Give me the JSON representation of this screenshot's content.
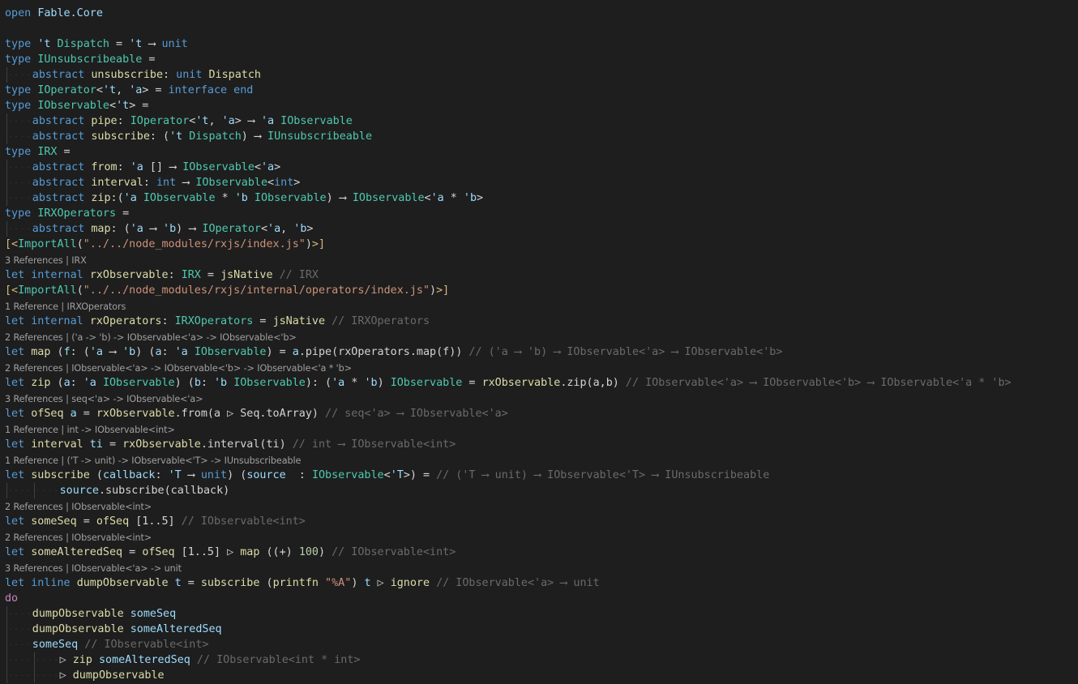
{
  "editor": {
    "language": "F#",
    "lines": [
      {
        "type": "code",
        "indent": 0,
        "tokens": [
          [
            "kw",
            "open "
          ],
          [
            "ty2",
            "Fable.Core"
          ]
        ]
      },
      {
        "type": "code",
        "indent": 0,
        "tokens": [
          [
            "op",
            ""
          ]
        ]
      },
      {
        "type": "code",
        "indent": 0,
        "tokens": [
          [
            "kw",
            "type "
          ],
          [
            "tv",
            "'t "
          ],
          [
            "ty",
            "Dispatch"
          ],
          [
            "op",
            " = "
          ],
          [
            "tv",
            "'t"
          ],
          [
            "op",
            " ⟶ "
          ],
          [
            "kw",
            "unit"
          ]
        ]
      },
      {
        "type": "code",
        "indent": 0,
        "tokens": [
          [
            "kw",
            "type "
          ],
          [
            "ty",
            "IUnsubscribeable"
          ],
          [
            "op",
            " ="
          ]
        ]
      },
      {
        "type": "code",
        "indent": 1,
        "tokens": [
          [
            "kw",
            "abstract "
          ],
          [
            "fn",
            "unsubscribe"
          ],
          [
            "op",
            ": "
          ],
          [
            "kw",
            "unit "
          ],
          [
            "fn",
            "Dispatch"
          ]
        ]
      },
      {
        "type": "code",
        "indent": 0,
        "tokens": [
          [
            "kw",
            "type "
          ],
          [
            "ty",
            "IOperator"
          ],
          [
            "op",
            "<"
          ],
          [
            "tv",
            "'t"
          ],
          [
            "op",
            ", "
          ],
          [
            "tv",
            "'a"
          ],
          [
            "op",
            "> = "
          ],
          [
            "kw",
            "interface end"
          ]
        ]
      },
      {
        "type": "code",
        "indent": 0,
        "tokens": [
          [
            "kw",
            "type "
          ],
          [
            "ty",
            "IObservable"
          ],
          [
            "op",
            "<"
          ],
          [
            "tv",
            "'t"
          ],
          [
            "op",
            "> ="
          ]
        ]
      },
      {
        "type": "code",
        "indent": 1,
        "tokens": [
          [
            "kw",
            "abstract "
          ],
          [
            "fn",
            "pipe"
          ],
          [
            "op",
            ": "
          ],
          [
            "ty",
            "IOperator"
          ],
          [
            "op",
            "<"
          ],
          [
            "tv",
            "'t"
          ],
          [
            "op",
            ", "
          ],
          [
            "tv",
            "'a"
          ],
          [
            "op",
            "> ⟶ "
          ],
          [
            "tv",
            "'a "
          ],
          [
            "ty",
            "IObservable"
          ]
        ]
      },
      {
        "type": "code",
        "indent": 1,
        "tokens": [
          [
            "kw",
            "abstract "
          ],
          [
            "fn",
            "subscribe"
          ],
          [
            "op",
            ": ("
          ],
          [
            "tv",
            "'t "
          ],
          [
            "ty",
            "Dispatch"
          ],
          [
            "op",
            ") ⟶ "
          ],
          [
            "ty",
            "IUnsubscribeable"
          ]
        ]
      },
      {
        "type": "code",
        "indent": 0,
        "tokens": [
          [
            "kw",
            "type "
          ],
          [
            "ty",
            "IRX"
          ],
          [
            "op",
            " ="
          ]
        ]
      },
      {
        "type": "code",
        "indent": 1,
        "tokens": [
          [
            "kw",
            "abstract "
          ],
          [
            "fn",
            "from"
          ],
          [
            "op",
            ": "
          ],
          [
            "tv",
            "'a "
          ],
          [
            "op",
            "[] ⟶ "
          ],
          [
            "ty",
            "IObservable"
          ],
          [
            "op",
            "<"
          ],
          [
            "tv",
            "'a"
          ],
          [
            "op",
            ">"
          ]
        ]
      },
      {
        "type": "code",
        "indent": 1,
        "tokens": [
          [
            "kw",
            "abstract "
          ],
          [
            "fn",
            "interval"
          ],
          [
            "op",
            ": "
          ],
          [
            "kw",
            "int"
          ],
          [
            "op",
            " ⟶ "
          ],
          [
            "ty",
            "IObservable"
          ],
          [
            "op",
            "<"
          ],
          [
            "kw",
            "int"
          ],
          [
            "op",
            ">"
          ]
        ]
      },
      {
        "type": "code",
        "indent": 1,
        "tokens": [
          [
            "kw",
            "abstract "
          ],
          [
            "fn",
            "zip"
          ],
          [
            "op",
            ":("
          ],
          [
            "tv",
            "'a "
          ],
          [
            "ty",
            "IObservable"
          ],
          [
            "op",
            " * "
          ],
          [
            "tv",
            "'b "
          ],
          [
            "ty",
            "IObservable"
          ],
          [
            "op",
            ") ⟶ "
          ],
          [
            "ty",
            "IObservable"
          ],
          [
            "op",
            "<"
          ],
          [
            "tv",
            "'a"
          ],
          [
            "op",
            " * "
          ],
          [
            "tv",
            "'b"
          ],
          [
            "op",
            ">"
          ]
        ]
      },
      {
        "type": "code",
        "indent": 0,
        "tokens": [
          [
            "kw",
            "type "
          ],
          [
            "ty",
            "IRXOperators"
          ],
          [
            "op",
            " ="
          ]
        ]
      },
      {
        "type": "code",
        "indent": 1,
        "tokens": [
          [
            "kw",
            "abstract "
          ],
          [
            "fn",
            "map"
          ],
          [
            "op",
            ": ("
          ],
          [
            "tv",
            "'a"
          ],
          [
            "op",
            " ⟶ "
          ],
          [
            "tv",
            "'b"
          ],
          [
            "op",
            ") ⟶ "
          ],
          [
            "ty",
            "IOperator"
          ],
          [
            "op",
            "<"
          ],
          [
            "tv",
            "'a"
          ],
          [
            "op",
            ", "
          ],
          [
            "tv",
            "'b"
          ],
          [
            "op",
            ">"
          ]
        ]
      },
      {
        "type": "code",
        "indent": 0,
        "tokens": [
          [
            "attr",
            "[<"
          ],
          [
            "ty",
            "ImportAll"
          ],
          [
            "op",
            "("
          ],
          [
            "str",
            "\"../../node_modules/rxjs/index.js\""
          ],
          [
            "op",
            ")"
          ],
          [
            "attr",
            ">]"
          ]
        ]
      },
      {
        "type": "lens",
        "text": "3 References | IRX"
      },
      {
        "type": "code",
        "indent": 0,
        "tokens": [
          [
            "kw",
            "let "
          ],
          [
            "kw",
            "internal "
          ],
          [
            "fn",
            "rxObservable"
          ],
          [
            "op",
            ": "
          ],
          [
            "ty",
            "IRX"
          ],
          [
            "op",
            " = "
          ],
          [
            "fn",
            "jsNative"
          ],
          [
            "cm",
            " // IRX"
          ]
        ]
      },
      {
        "type": "code",
        "indent": 0,
        "tokens": [
          [
            "attr",
            "[<"
          ],
          [
            "ty",
            "ImportAll"
          ],
          [
            "op",
            "("
          ],
          [
            "str",
            "\"../../node_modules/rxjs/internal/operators/index.js\""
          ],
          [
            "op",
            ")"
          ],
          [
            "attr",
            ">]"
          ]
        ]
      },
      {
        "type": "lens",
        "text": "1 Reference | IRXOperators"
      },
      {
        "type": "code",
        "indent": 0,
        "tokens": [
          [
            "kw",
            "let "
          ],
          [
            "kw",
            "internal "
          ],
          [
            "fn",
            "rxOperators"
          ],
          [
            "op",
            ": "
          ],
          [
            "ty",
            "IRXOperators"
          ],
          [
            "op",
            " = "
          ],
          [
            "fn",
            "jsNative"
          ],
          [
            "cm",
            " // IRXOperators"
          ]
        ]
      },
      {
        "type": "lens",
        "text": "2 References | ('a -> 'b) -> IObservable<'a> -> IObservable<'b>"
      },
      {
        "type": "code",
        "indent": 0,
        "tokens": [
          [
            "kw",
            "let "
          ],
          [
            "fn",
            "map"
          ],
          [
            "op",
            " ("
          ],
          [
            "id",
            "f"
          ],
          [
            "op",
            ": ("
          ],
          [
            "tv",
            "'a"
          ],
          [
            "op",
            " ⟶ "
          ],
          [
            "tv",
            "'b"
          ],
          [
            "op",
            ") ("
          ],
          [
            "id",
            "a"
          ],
          [
            "op",
            ": "
          ],
          [
            "tv",
            "'a "
          ],
          [
            "ty",
            "IObservable"
          ],
          [
            "op",
            ") = "
          ],
          [
            "id",
            "a"
          ],
          [
            "op",
            ".pipe(rxOperators.map(f))"
          ],
          [
            "cm",
            " // ('a ⟶ 'b) ⟶ IObservable<'a> ⟶ IObservable<'b>"
          ]
        ]
      },
      {
        "type": "lens",
        "text": "2 References | IObservable<'a> -> IObservable<'b> -> IObservable<'a * 'b>"
      },
      {
        "type": "code",
        "indent": 0,
        "tokens": [
          [
            "kw",
            "let "
          ],
          [
            "fn",
            "zip"
          ],
          [
            "op",
            " ("
          ],
          [
            "id",
            "a"
          ],
          [
            "op",
            ": "
          ],
          [
            "tv",
            "'a "
          ],
          [
            "ty",
            "IObservable"
          ],
          [
            "op",
            ") ("
          ],
          [
            "id",
            "b"
          ],
          [
            "op",
            ": "
          ],
          [
            "tv",
            "'b "
          ],
          [
            "ty",
            "IObservable"
          ],
          [
            "op",
            "): ("
          ],
          [
            "tv",
            "'a"
          ],
          [
            "op",
            " * "
          ],
          [
            "tv",
            "'b"
          ],
          [
            "op",
            ") "
          ],
          [
            "ty",
            "IObservable"
          ],
          [
            "op",
            " = "
          ],
          [
            "fn",
            "rxObservable"
          ],
          [
            "op",
            ".zip(a,b)"
          ],
          [
            "cm",
            " // IObservable<'a> ⟶ IObservable<'b> ⟶ IObservable<'a * 'b>"
          ]
        ]
      },
      {
        "type": "lens",
        "text": "3 References | seq<'a> -> IObservable<'a>"
      },
      {
        "type": "code",
        "indent": 0,
        "tokens": [
          [
            "kw",
            "let "
          ],
          [
            "fn",
            "ofSeq"
          ],
          [
            "id",
            " a"
          ],
          [
            "op",
            " = "
          ],
          [
            "fn",
            "rxObservable"
          ],
          [
            "op",
            ".from(a ▷ Seq.toArray)"
          ],
          [
            "cm",
            " // seq<'a> ⟶ IObservable<'a>"
          ]
        ]
      },
      {
        "type": "lens",
        "text": "1 Reference | int -> IObservable<int>"
      },
      {
        "type": "code",
        "indent": 0,
        "tokens": [
          [
            "kw",
            "let "
          ],
          [
            "fn",
            "interval"
          ],
          [
            "id",
            " ti"
          ],
          [
            "op",
            " = "
          ],
          [
            "fn",
            "rxObservable"
          ],
          [
            "op",
            ".interval(ti)"
          ],
          [
            "cm",
            " // int ⟶ IObservable<int>"
          ]
        ]
      },
      {
        "type": "lens",
        "text": "1 Reference | ('T -> unit) -> IObservable<'T> -> IUnsubscribeable"
      },
      {
        "type": "code",
        "indent": 0,
        "tokens": [
          [
            "kw",
            "let "
          ],
          [
            "fn",
            "subscribe"
          ],
          [
            "op",
            " ("
          ],
          [
            "id",
            "callback"
          ],
          [
            "op",
            ": "
          ],
          [
            "tv",
            "'T"
          ],
          [
            "op",
            " ⟶ "
          ],
          [
            "kw",
            "unit"
          ],
          [
            "op",
            ") ("
          ],
          [
            "id",
            "source"
          ],
          [
            "op",
            "  : "
          ],
          [
            "ty",
            "IObservable"
          ],
          [
            "op",
            "<"
          ],
          [
            "tv",
            "'T"
          ],
          [
            "op",
            ">) ="
          ],
          [
            "cm",
            " // ('T ⟶ unit) ⟶ IObservable<'T> ⟶ IUnsubscribeable"
          ]
        ]
      },
      {
        "type": "code",
        "indent": 2,
        "tokens": [
          [
            "id",
            "source"
          ],
          [
            "op",
            ".subscribe(callback)"
          ]
        ]
      },
      {
        "type": "lens",
        "text": "2 References | IObservable<int>"
      },
      {
        "type": "code",
        "indent": 0,
        "tokens": [
          [
            "kw",
            "let "
          ],
          [
            "fn",
            "someSeq"
          ],
          [
            "op",
            " = "
          ],
          [
            "fn",
            "ofSeq"
          ],
          [
            "op",
            " [1..5]"
          ],
          [
            "cm",
            " // IObservable<int>"
          ]
        ]
      },
      {
        "type": "lens",
        "text": "2 References | IObservable<int>"
      },
      {
        "type": "code",
        "indent": 0,
        "tokens": [
          [
            "kw",
            "let "
          ],
          [
            "fn",
            "someAlteredSeq"
          ],
          [
            "op",
            " = "
          ],
          [
            "fn",
            "ofSeq"
          ],
          [
            "op",
            " [1..5] ▷ "
          ],
          [
            "fn",
            "map"
          ],
          [
            "op",
            " ((+) "
          ],
          [
            "num",
            "100"
          ],
          [
            "op",
            ")"
          ],
          [
            "cm",
            " // IObservable<int>"
          ]
        ]
      },
      {
        "type": "lens",
        "text": "3 References | IObservable<'a> -> unit"
      },
      {
        "type": "code",
        "indent": 0,
        "tokens": [
          [
            "kw",
            "let "
          ],
          [
            "kw",
            "inline "
          ],
          [
            "fn",
            "dumpObservable"
          ],
          [
            "id",
            " t"
          ],
          [
            "op",
            " = "
          ],
          [
            "fn",
            "subscribe"
          ],
          [
            "op",
            " ("
          ],
          [
            "fn",
            "printfn"
          ],
          [
            "str",
            " \"%A\""
          ],
          [
            "op",
            ") "
          ],
          [
            "id",
            "t"
          ],
          [
            "op",
            " ▷ "
          ],
          [
            "fn",
            "ignore"
          ],
          [
            "cm",
            " // IObservable<'a> ⟶ unit"
          ]
        ]
      },
      {
        "type": "code",
        "indent": 0,
        "tokens": [
          [
            "ctl",
            "do"
          ]
        ]
      },
      {
        "type": "code",
        "indent": 1,
        "tokens": [
          [
            "fn",
            "dumpObservable"
          ],
          [
            "id",
            " someSeq"
          ]
        ]
      },
      {
        "type": "code",
        "indent": 1,
        "tokens": [
          [
            "fn",
            "dumpObservable"
          ],
          [
            "id",
            " someAlteredSeq"
          ]
        ]
      },
      {
        "type": "code",
        "indent": 1,
        "tokens": [
          [
            "id",
            "someSeq"
          ],
          [
            "cm",
            " // IObservable<int>"
          ]
        ]
      },
      {
        "type": "code",
        "indent": 2,
        "tokens": [
          [
            "op",
            "▷ "
          ],
          [
            "fn",
            "zip"
          ],
          [
            "id",
            " someAlteredSeq"
          ],
          [
            "cm",
            " // IObservable<int * int>"
          ]
        ]
      },
      {
        "type": "code",
        "indent": 2,
        "tokens": [
          [
            "op",
            "▷ "
          ],
          [
            "fn",
            "dumpObservable"
          ]
        ]
      }
    ]
  }
}
